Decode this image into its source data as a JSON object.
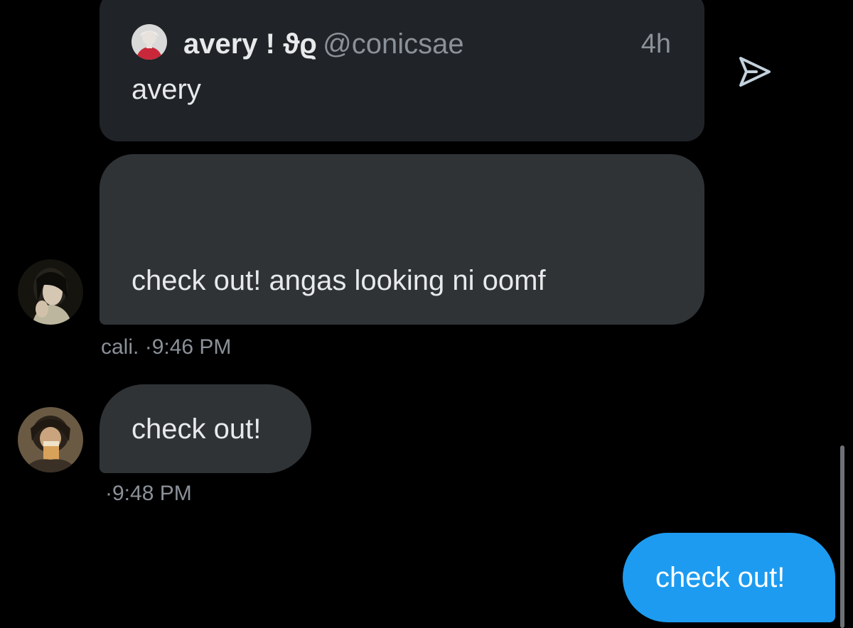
{
  "quoted_post": {
    "display_name": "avery ! ϑϱ",
    "handle": "@conicsae",
    "time": "4h",
    "text": "avery",
    "avatar_icon": "user-avatar"
  },
  "share_icon": "send-icon",
  "messages": [
    {
      "text": "check out! angas looking ni oomf",
      "sender": "cali.",
      "time": "·9:46 PM",
      "direction": "incoming"
    },
    {
      "text": "check out!",
      "time": "·9:48 PM",
      "direction": "incoming"
    },
    {
      "text": "check out!",
      "direction": "outgoing"
    }
  ],
  "colors": {
    "background": "#000000",
    "quote_card": "#202327",
    "incoming_bubble": "#2f3336",
    "outgoing_bubble": "#1d9bf0",
    "muted_text": "#8b9198"
  }
}
